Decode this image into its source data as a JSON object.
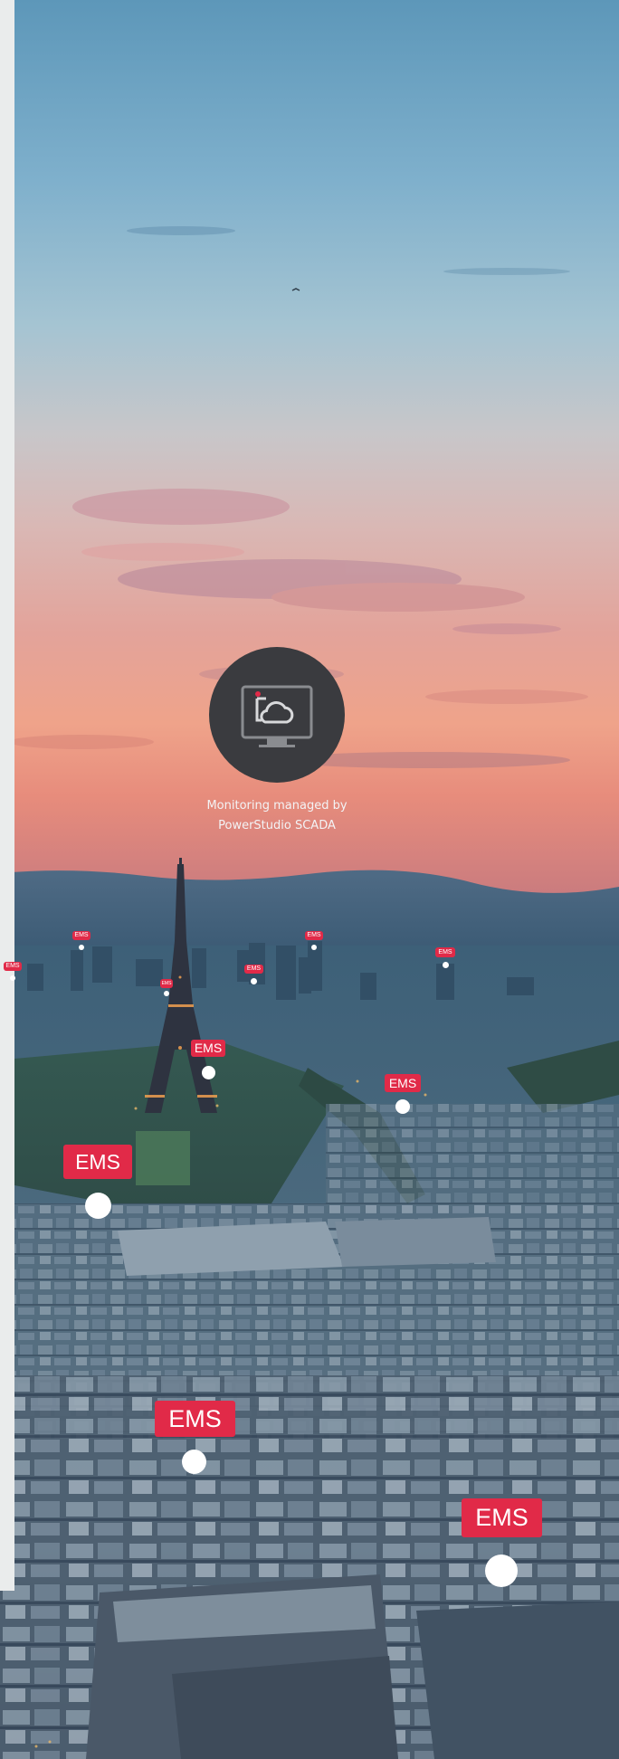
{
  "monitor": {
    "icon": "cloud-monitor-icon",
    "caption_line1": "Monitoring managed by",
    "caption_line2": "PowerStudio SCADA"
  },
  "markers": [
    {
      "label": "EMS"
    },
    {
      "label": "EMS"
    },
    {
      "label": "EMS"
    },
    {
      "label": "EMS"
    },
    {
      "label": "EMS"
    },
    {
      "label": "EMS"
    },
    {
      "label": "EMS"
    },
    {
      "label": "EMS"
    },
    {
      "label": "EMS"
    },
    {
      "label": "EMS"
    },
    {
      "label": "EMS"
    },
    {
      "label": "EMS"
    }
  ],
  "colors": {
    "marker_tag": "#e12a48",
    "marker_dot": "#ffffff",
    "badge": "#3a3b3f",
    "caption": "#f3f3f5"
  }
}
